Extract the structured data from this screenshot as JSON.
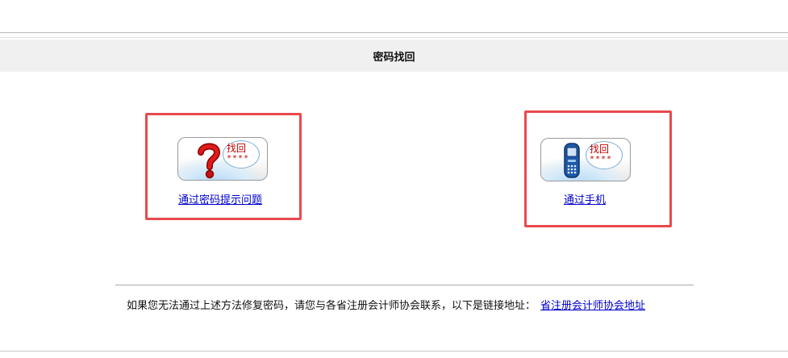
{
  "page_title": "密码找回",
  "options": [
    {
      "bubble_text": "找回",
      "bubble_stars": "****",
      "link_label": "通过密码提示问题",
      "icon": "question-mark-icon"
    },
    {
      "bubble_text": "找回",
      "bubble_stars": "****",
      "link_label": "通过手机",
      "icon": "mobile-phone-icon"
    }
  ],
  "footer": {
    "message": "如果您无法通过上述方法修复密码，请您与各省注册会计师协会联系，以下是链接地址：",
    "link_label": "省注册会计师协会地址"
  },
  "colors": {
    "highlight_border": "#e8494d",
    "link": "#0000cc",
    "title_bar_bg": "#f0f0f0",
    "bubble_text": "#c00000"
  }
}
